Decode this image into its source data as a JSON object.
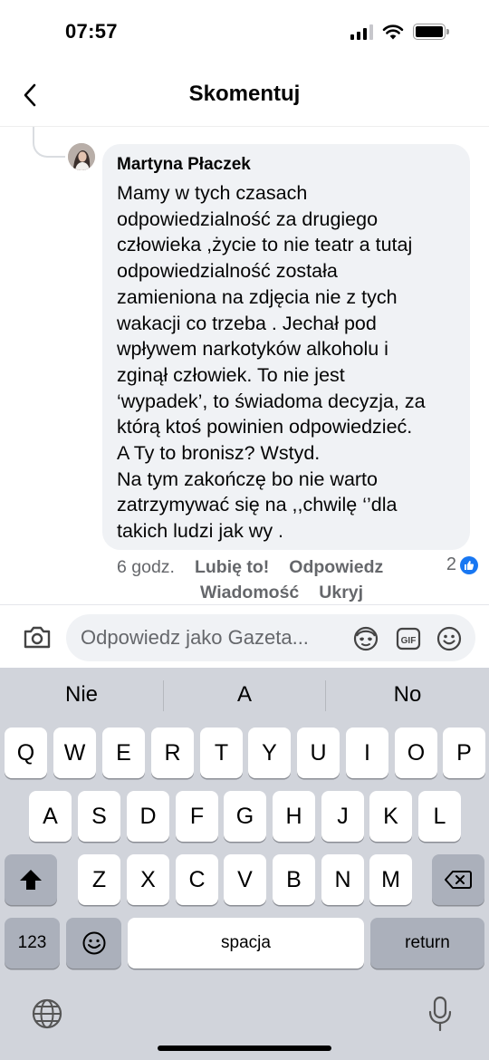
{
  "status_bar": {
    "time": "07:57"
  },
  "header": {
    "title": "Skomentuj"
  },
  "comment": {
    "author": "Martyna Płaczek",
    "text": "Mamy w tych czasach\nodpowiedzialność za drugiego\nczłowieka ,życie to nie teatr a tutaj\nodpowiedzialność została\nzamieniona na zdjęcia nie z tych\nwakacji co trzeba . Jechał pod\nwpływem narkotyków alkoholu i\nzginął człowiek. To nie jest\n‘wypadek’, to świadoma decyzja, za\nktórą ktoś powinien odpowiedzieć.\nA Ty to bronisz? Wstyd.\nNa tym zakończę bo nie warto\nzatrzymywać się na ,,chwilę ‘’dla\ntakich ludzi jak wy .",
    "time": "6 godz.",
    "like_label": "Lubię to!",
    "reply_label": "Odpowiedz",
    "message_label": "Wiadomość",
    "hide_label": "Ukryj",
    "reaction_count": "2",
    "reaction_icon": "like-icon"
  },
  "composer": {
    "placeholder": "Odpowiedz jako Gazeta..."
  },
  "keyboard": {
    "suggestions": [
      "Nie",
      "A",
      "No"
    ],
    "row1": [
      "Q",
      "W",
      "E",
      "R",
      "T",
      "Y",
      "U",
      "I",
      "O",
      "P"
    ],
    "row2": [
      "A",
      "S",
      "D",
      "F",
      "G",
      "H",
      "J",
      "K",
      "L"
    ],
    "row3": [
      "Z",
      "X",
      "C",
      "V",
      "B",
      "N",
      "M"
    ],
    "numbers_label": "123",
    "space_label": "spacja",
    "return_label": "return"
  },
  "colors": {
    "accent": "#1877f2",
    "bubble": "#f0f2f5",
    "secondary_text": "#65676b",
    "keyboard_bg": "#d1d4db"
  }
}
